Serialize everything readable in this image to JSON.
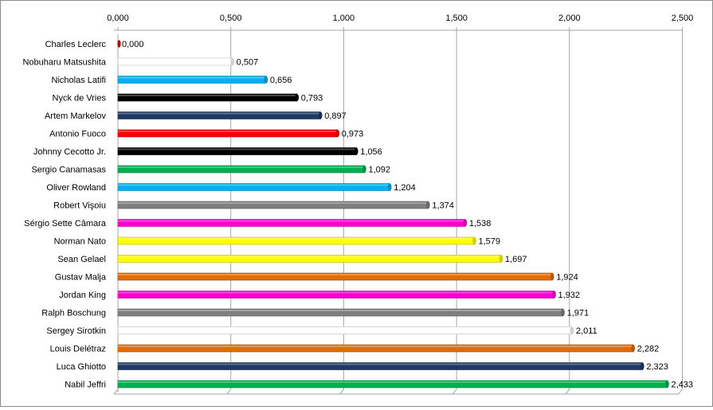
{
  "chart_data": {
    "type": "bar",
    "orientation": "horizontal",
    "title": "",
    "xlabel": "",
    "ylabel": "",
    "xlim": [
      0,
      2.5
    ],
    "ticks": [
      "0,000",
      "0,500",
      "1,000",
      "1,500",
      "2,000",
      "2,500"
    ],
    "tick_values": [
      0,
      0.5,
      1.0,
      1.5,
      2.0,
      2.5
    ],
    "grid": true,
    "axis_position": "top",
    "categories": [
      "Charles Leclerc",
      "Nobuharu Matsushita",
      "Nicholas Latifi",
      "Nyck de Vries",
      "Artem Markelov",
      "Antonio Fuoco",
      "Johnny Cecotto Jr.",
      "Sergio Canamasas",
      "Oliver Rowland",
      "Robert Vişoiu",
      "Sérgio Sette Câmara",
      "Norman Nato",
      "Sean Gelael",
      "Gustav Malja",
      "Jordan King",
      "Ralph Boschung",
      "Sergey Sirotkin",
      "Louis Delétraz",
      "Luca Ghiotto",
      "Nabil Jeffri"
    ],
    "values": [
      0.0,
      0.507,
      0.656,
      0.793,
      0.897,
      0.973,
      1.056,
      1.092,
      1.204,
      1.374,
      1.538,
      1.579,
      1.697,
      1.924,
      1.932,
      1.971,
      2.011,
      2.282,
      2.323,
      2.433
    ],
    "value_labels": [
      "0,000",
      "0,507",
      "0,656",
      "0,793",
      "0,897",
      "0,973",
      "1,056",
      "1,092",
      "1,204",
      "1,374",
      "1,538",
      "1,579",
      "1,697",
      "1,924",
      "1,932",
      "1,971",
      "2,011",
      "2,282",
      "2,323",
      "2,433"
    ],
    "colors": [
      "#c00000",
      "#ffffff",
      "#00b0f0",
      "#000000",
      "#1f3864",
      "#ff0000",
      "#000000",
      "#00b050",
      "#00b0f0",
      "#7f7f7f",
      "#ff00cc",
      "#ffff00",
      "#ffff00",
      "#e36c09",
      "#ff00cc",
      "#7f7f7f",
      "#ffffff",
      "#e36c09",
      "#1f3864",
      "#00b050"
    ]
  }
}
